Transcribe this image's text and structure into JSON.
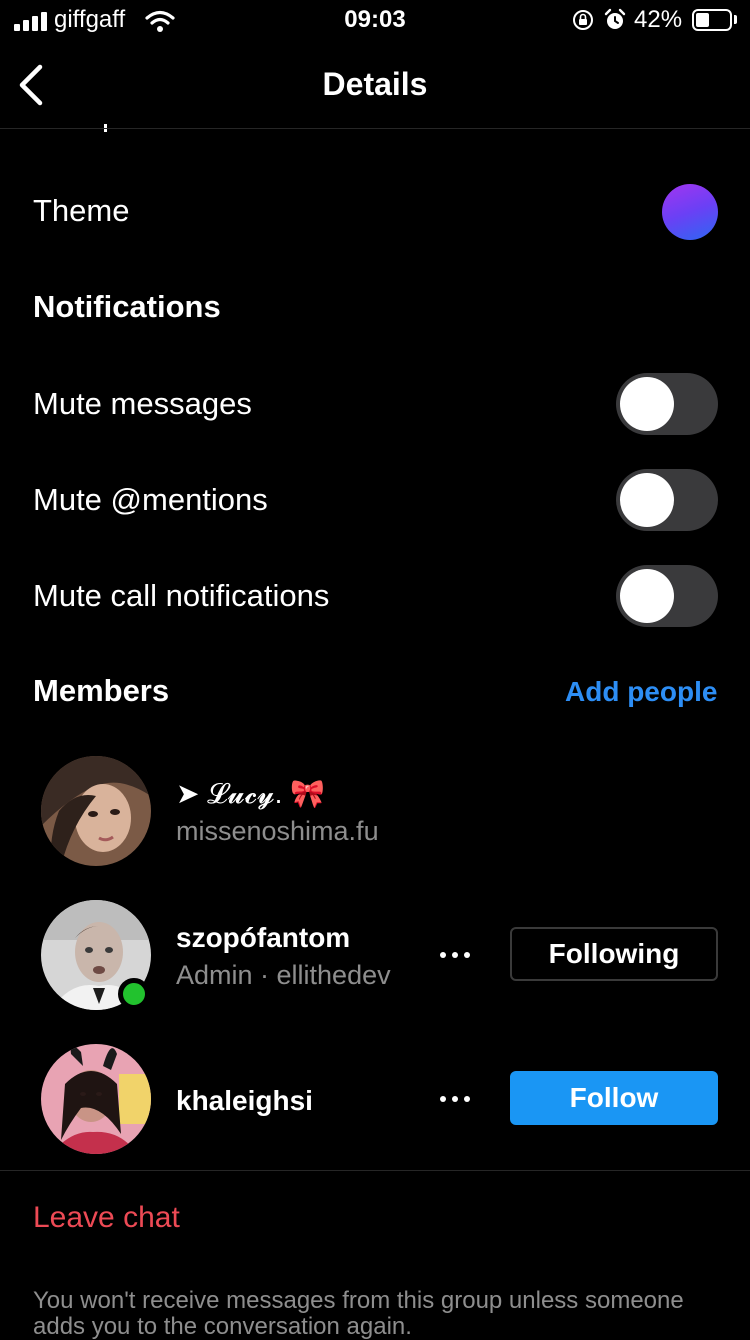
{
  "status": {
    "carrier": "giffgaff",
    "time": "09:03",
    "battery_percent": "42%",
    "battery_level": 0.42
  },
  "nav": {
    "title": "Details"
  },
  "theme": {
    "label": "Theme",
    "gradient_colors": [
      "#a235f0",
      "#2d67f2"
    ]
  },
  "notifications": {
    "title": "Notifications",
    "items": [
      {
        "label": "Mute messages",
        "on": false
      },
      {
        "label": "Mute @mentions",
        "on": false
      },
      {
        "label": "Mute call notifications",
        "on": false
      }
    ]
  },
  "members": {
    "title": "Members",
    "add_label": "Add people",
    "list": [
      {
        "name": "➤ 𝓛𝓾𝓬𝔂. 🎀",
        "subtitle": "missenoshima.fu"
      },
      {
        "name": "szopófantom",
        "subtitle": "Admin · ellithedev",
        "online": true,
        "button": "Following"
      },
      {
        "name": "khaleighsi",
        "button": "Follow"
      }
    ]
  },
  "leave_label": "Leave chat",
  "footnote": "You won't receive messages from this group unless someone adds you to the conversation again.",
  "colors": {
    "accent_blue": "#1a96f4",
    "link_blue": "#2d8ef5",
    "danger": "#ed4a55",
    "online": "#22c22e"
  },
  "icons": [
    "cellular-signal-icon",
    "wifi-icon",
    "orientation-lock-icon",
    "alarm-icon",
    "battery-icon",
    "back-chevron-icon",
    "more-dots-icon"
  ]
}
